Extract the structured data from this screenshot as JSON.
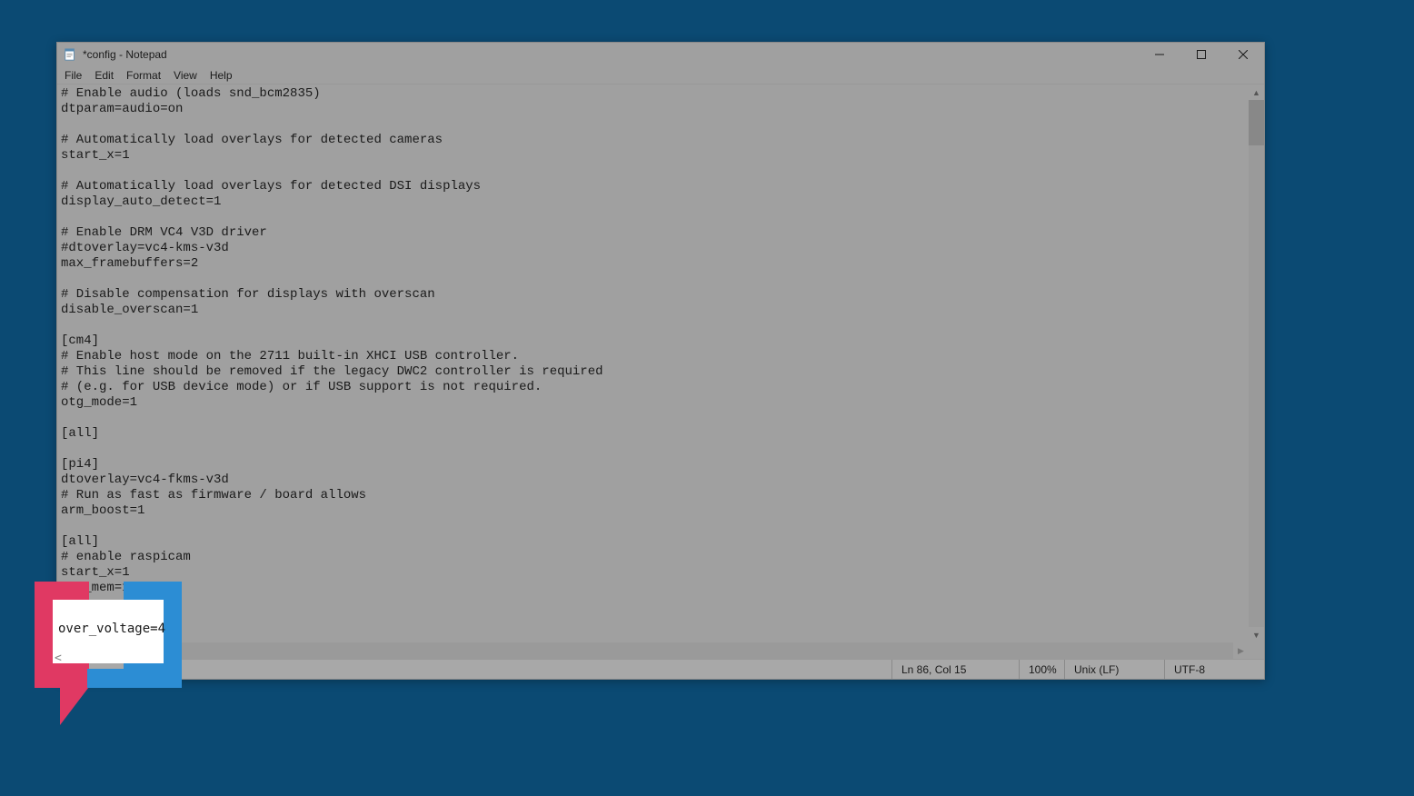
{
  "window": {
    "title": "*config - Notepad"
  },
  "menu": {
    "file": "File",
    "edit": "Edit",
    "format": "Format",
    "view": "View",
    "help": "Help"
  },
  "editor": {
    "content": "# Enable audio (loads snd_bcm2835)\ndtparam=audio=on\n\n# Automatically load overlays for detected cameras\nstart_x=1\n\n# Automatically load overlays for detected DSI displays\ndisplay_auto_detect=1\n\n# Enable DRM VC4 V3D driver\n#dtoverlay=vc4-kms-v3d\nmax_framebuffers=2\n\n# Disable compensation for displays with overscan\ndisable_overscan=1\n\n[cm4]\n# Enable host mode on the 2711 built-in XHCI USB controller.\n# This line should be removed if the legacy DWC2 controller is required\n# (e.g. for USB device mode) or if USB support is not required.\notg_mode=1\n\n[all]\n\n[pi4]\ndtoverlay=vc4-fkms-v3d\n# Run as fast as firmware / board allows\narm_boost=1\n\n[all]\n# enable raspicam\nstart_x=1\ngpu_mem=128\n\nover_voltage=4"
  },
  "statusbar": {
    "position": "Ln 86, Col 15",
    "zoom": "100%",
    "eol": "Unix (LF)",
    "encoding": "UTF-8"
  },
  "callout": {
    "text": "over_voltage=4",
    "arrow": "<"
  }
}
